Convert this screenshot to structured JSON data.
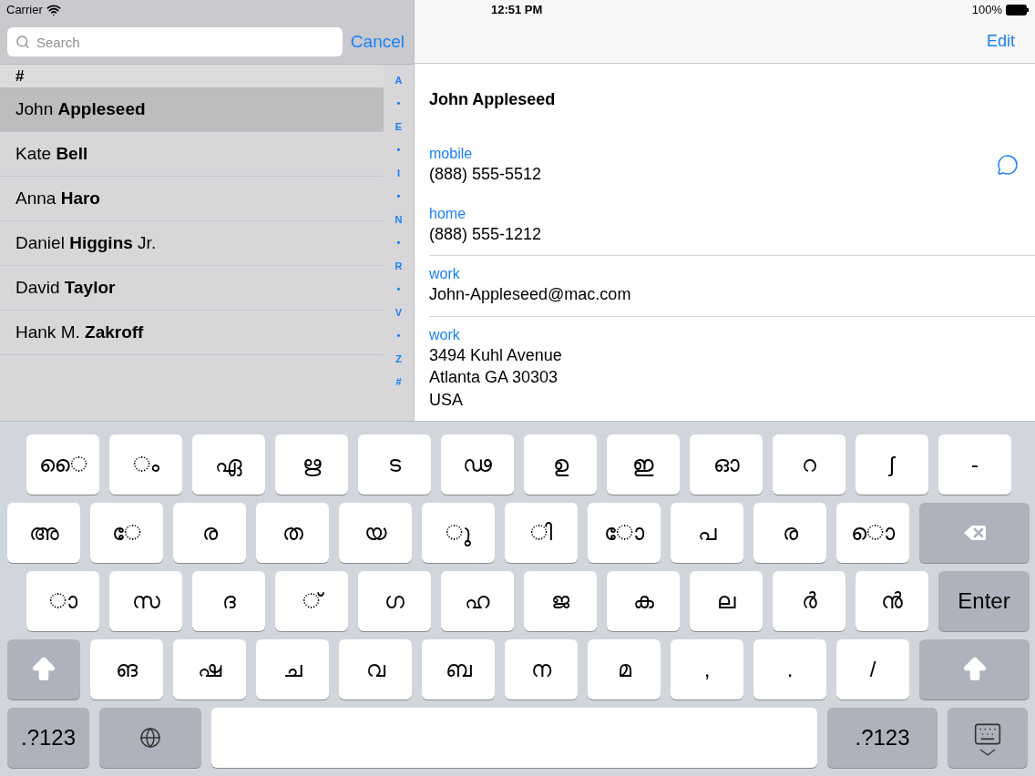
{
  "status_bar": {
    "carrier": "Carrier",
    "time": "12:51 PM",
    "battery": "100%"
  },
  "search": {
    "placeholder": "Search",
    "cancel": "Cancel"
  },
  "edit": "Edit",
  "section_header": "#",
  "contacts": [
    {
      "name": "John **Appleseed**",
      "selected": true
    },
    {
      "name": "Kate **Bell**",
      "selected": false
    },
    {
      "name": "Anna **Haro**",
      "selected": false
    },
    {
      "name": "Daniel **Higgins** Jr.",
      "selected": false
    },
    {
      "name": "David **Taylor**",
      "selected": false
    },
    {
      "name": "Hank M. **Zakroff**",
      "selected": false
    }
  ],
  "index": [
    "A",
    "•",
    "E",
    "•",
    "I",
    "•",
    "N",
    "•",
    "R",
    "•",
    "V",
    "•",
    "Z",
    "#"
  ],
  "detail": {
    "name": "John Appleseed",
    "fields": [
      {
        "label": "mobile",
        "lines": [
          "(888) 555-5512"
        ],
        "message": true
      },
      {
        "label": "home",
        "lines": [
          "(888) 555-1212"
        ],
        "message": false
      },
      {
        "label": "work",
        "lines": [
          "John-Appleseed@mac.com"
        ],
        "message": false
      },
      {
        "label": "work",
        "lines": [
          "3494 Kuhl Avenue",
          "Atlanta GA 30303",
          "USA"
        ],
        "message": false
      }
    ]
  },
  "keyboard": [
    [
      {
        "kind": "char",
        "label": "◌ൈ"
      },
      {
        "kind": "char",
        "label": "ം"
      },
      {
        "kind": "char",
        "label": "ഏ"
      },
      {
        "kind": "char",
        "label": "ഋ"
      },
      {
        "kind": "char",
        "label": "ട"
      },
      {
        "kind": "char",
        "label": "ഢ"
      },
      {
        "kind": "char",
        "label": "ഉ"
      },
      {
        "kind": "char",
        "label": "ഇ"
      },
      {
        "kind": "char",
        "label": "ഓ"
      },
      {
        "kind": "char",
        "label": "റ"
      },
      {
        "kind": "char",
        "label": "ʃ"
      },
      {
        "kind": "char",
        "label": "-"
      }
    ],
    [
      {
        "kind": "char",
        "label": "അ"
      },
      {
        "kind": "char",
        "label": "◌േ"
      },
      {
        "kind": "char",
        "label": "ര"
      },
      {
        "kind": "char",
        "label": "ത"
      },
      {
        "kind": "char",
        "label": "യ"
      },
      {
        "kind": "char",
        "label": "◌ു"
      },
      {
        "kind": "char",
        "label": "◌ി"
      },
      {
        "kind": "char",
        "label": "◌ോ"
      },
      {
        "kind": "char",
        "label": "പ"
      },
      {
        "kind": "char",
        "label": "ര"
      },
      {
        "kind": "char",
        "label": "◌ൊ"
      },
      {
        "kind": "delete"
      }
    ],
    [
      {
        "kind": "char",
        "label": "◌ാ"
      },
      {
        "kind": "char",
        "label": "സ"
      },
      {
        "kind": "char",
        "label": "ദ"
      },
      {
        "kind": "char",
        "label": "◌്"
      },
      {
        "kind": "char",
        "label": "ഗ"
      },
      {
        "kind": "char",
        "label": "ഹ"
      },
      {
        "kind": "char",
        "label": "ജ"
      },
      {
        "kind": "char",
        "label": "ക"
      },
      {
        "kind": "char",
        "label": "ല"
      },
      {
        "kind": "char",
        "label": "ർ"
      },
      {
        "kind": "char",
        "label": "ൻ"
      },
      {
        "kind": "enter",
        "label": "Enter"
      }
    ],
    [
      {
        "kind": "shift"
      },
      {
        "kind": "char",
        "label": "ങ"
      },
      {
        "kind": "char",
        "label": "ഷ"
      },
      {
        "kind": "char",
        "label": "ച"
      },
      {
        "kind": "char",
        "label": "വ"
      },
      {
        "kind": "char",
        "label": "ബ"
      },
      {
        "kind": "char",
        "label": "ന"
      },
      {
        "kind": "char",
        "label": "മ"
      },
      {
        "kind": "char",
        "label": ","
      },
      {
        "kind": "char",
        "label": "."
      },
      {
        "kind": "char",
        "label": "/"
      },
      {
        "kind": "shift_right"
      }
    ],
    [
      {
        "kind": "numbers",
        "label": ".?123"
      },
      {
        "kind": "globe"
      },
      {
        "kind": "space"
      },
      {
        "kind": "numbers_right",
        "label": ".?123"
      },
      {
        "kind": "hide"
      }
    ]
  ]
}
